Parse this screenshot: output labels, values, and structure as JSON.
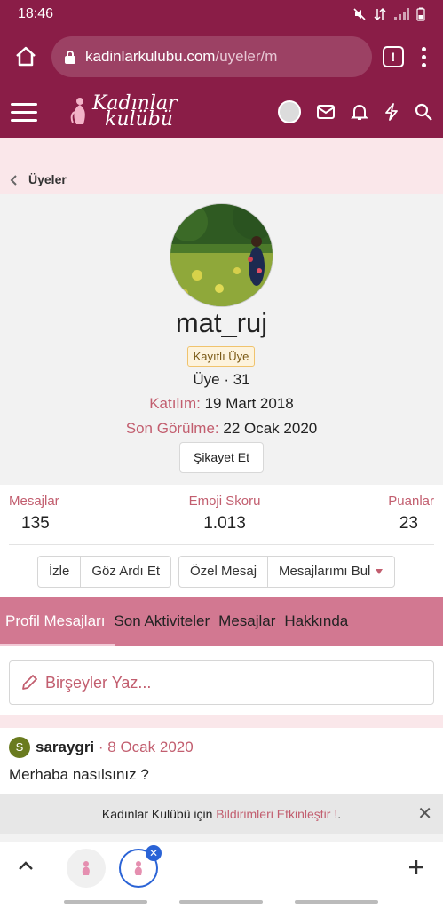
{
  "status": {
    "time": "18:46"
  },
  "browser": {
    "url_domain": "kadinlarkulubu.com",
    "url_path": "/uyeler/m",
    "tab_indicator": "!"
  },
  "breadcrumb": {
    "label": "Üyeler"
  },
  "profile": {
    "username": "mat_ruj",
    "badge": "Kayıtlı Üye",
    "role_line": "Üye · 31",
    "joined_label": "Katılım:",
    "joined_value": "19 Mart 2018",
    "last_seen_label": "Son Görülme:",
    "last_seen_value": "22 Ocak 2020",
    "report_label": "Şikayet Et"
  },
  "stats": [
    {
      "label": "Mesajlar",
      "value": "135"
    },
    {
      "label": "Emoji Skoru",
      "value": "1.013"
    },
    {
      "label": "Puanlar",
      "value": "23"
    }
  ],
  "actions": {
    "watch": "İzle",
    "ignore": "Göz Ardı Et",
    "private_message": "Özel Mesaj",
    "find_messages": "Mesajlarımı Bul"
  },
  "tabs": [
    {
      "label": "Profil Mesajları",
      "active": true
    },
    {
      "label": "Son Aktiviteler",
      "active": false
    },
    {
      "label": "Mesajlar",
      "active": false
    },
    {
      "label": "Hakkında",
      "active": false
    }
  ],
  "compose": {
    "placeholder": "Birşeyler Yaz..."
  },
  "message": {
    "avatar_letter": "S",
    "user": "saraygri",
    "separator": " · ",
    "date": "8 Ocak 2020",
    "text": "Merhaba nasılsınız ?"
  },
  "notice": {
    "prefix": "Kadınlar Kulübü için ",
    "link": "Bildirimleri Etkinleştir !",
    "suffix": "."
  },
  "logo": {
    "line1": "Kadınlar",
    "line2": "kulübü"
  },
  "colors": {
    "brand": "#8a1d47",
    "tabs_bg": "#d27891",
    "accent_text": "#c25e6f",
    "breadcrumb_bg": "#fae7ea"
  }
}
